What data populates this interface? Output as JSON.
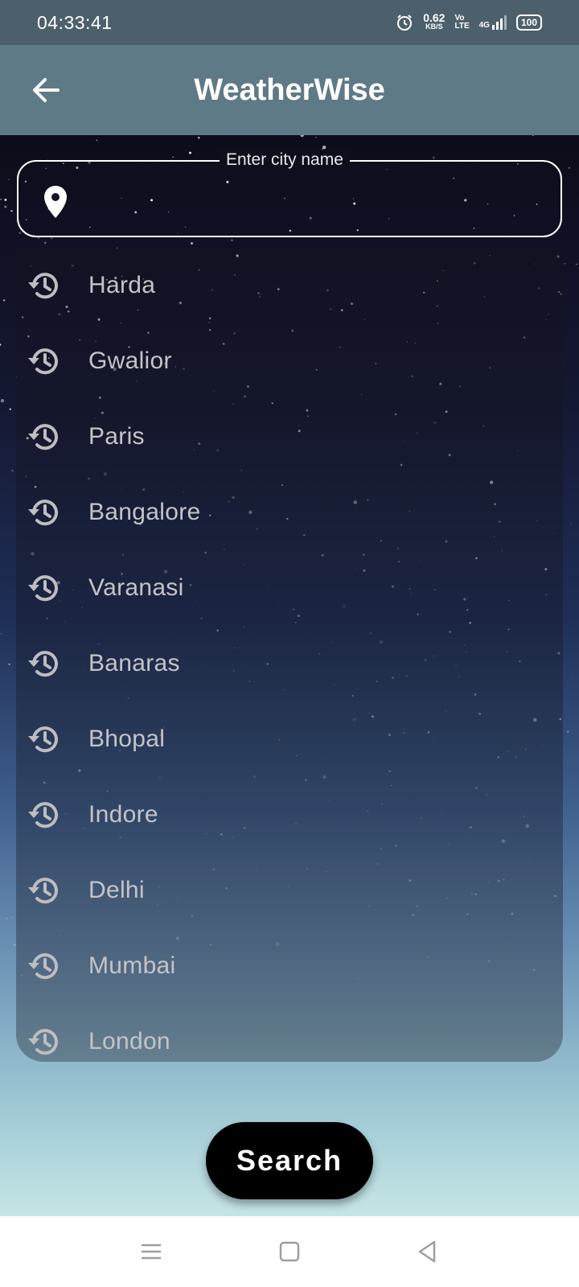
{
  "status_bar": {
    "time": "04:33:41",
    "net_speed": "0.62",
    "net_unit": "KB/S",
    "volte_top": "Vo",
    "volte_bottom": "LTE",
    "network": "4G",
    "battery": "100"
  },
  "app_bar": {
    "title": "WeatherWise",
    "back_icon": "arrow-left-icon"
  },
  "search": {
    "label": "Enter city name",
    "value": "",
    "icon": "location-pin-icon"
  },
  "history": {
    "icon": "history-icon",
    "items": [
      {
        "label": "Harda"
      },
      {
        "label": "Gwalior"
      },
      {
        "label": "Paris"
      },
      {
        "label": "Bangalore"
      },
      {
        "label": "Varanasi"
      },
      {
        "label": "Banaras"
      },
      {
        "label": "Bhopal"
      },
      {
        "label": "Indore"
      },
      {
        "label": "Delhi"
      },
      {
        "label": "Mumbai"
      },
      {
        "label": "London"
      }
    ]
  },
  "search_button": {
    "label": "Search"
  },
  "nav_bar": {
    "menu_icon": "menu-icon",
    "home_icon": "home-square-icon",
    "back_icon": "back-triangle-icon"
  },
  "colors": {
    "status_bar": "#4c606b",
    "app_bar": "#5e7a86",
    "button": "#000000"
  }
}
